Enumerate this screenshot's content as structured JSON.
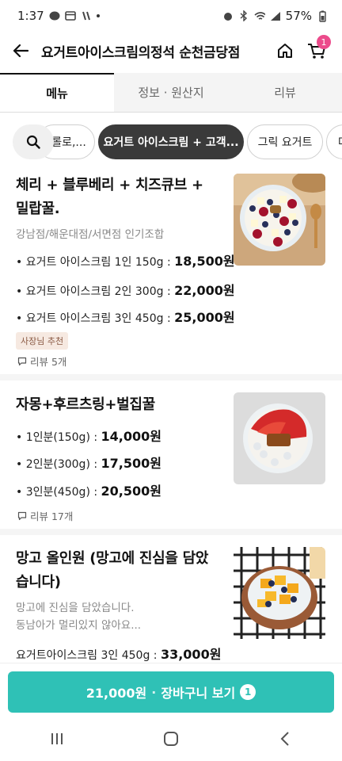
{
  "status_bar": {
    "time": "1:37",
    "battery": "57%"
  },
  "header": {
    "title": "요거트아이스크림의정석 순천금당점",
    "cart_count": "1"
  },
  "tabs": [
    {
      "label": "메뉴"
    },
    {
      "label": "정보 · 원산지"
    },
    {
      "label": "리뷰"
    }
  ],
  "chips": [
    {
      "label": "롤로,..."
    },
    {
      "label": "요거트 아이스크림 + 고객..."
    },
    {
      "label": "그릭 요거트"
    },
    {
      "label": "다"
    }
  ],
  "menu": [
    {
      "name": "체리 + 블루베리 + 치즈큐브 + 밀랍꿀.",
      "desc": "강남점/해운대점/서면점 인기조합",
      "prices": [
        {
          "label": "• 요거트 아이스크림 1인 150g : ",
          "price": "18,500원"
        },
        {
          "label": "• 요거트 아이스크림 2인 300g : ",
          "price": "22,000원"
        },
        {
          "label": "• 요거트 아이스크림 3인 450g : ",
          "price": "25,000원"
        }
      ],
      "tag": "사장님 추천",
      "review": "리뷰 5개"
    },
    {
      "name": "자몽+후르츠링+벌집꿀",
      "prices": [
        {
          "label": "• 1인분(150g) : ",
          "price": "14,000원"
        },
        {
          "label": "• 2인분(300g) : ",
          "price": "17,500원"
        },
        {
          "label": "• 3인분(450g) : ",
          "price": "20,500원"
        }
      ],
      "review": "리뷰 17개"
    },
    {
      "name": "망고 올인원 (망고에 진심을 담았습니다)",
      "desc_lines": [
        "망고에 진심을 담았습니다.",
        "동남아가 멀리있지 않아요..."
      ],
      "prices": [
        {
          "label": "요거트아이스크림 3인 450g : ",
          "price": "33,000원"
        }
      ]
    }
  ],
  "cart_bar": {
    "total": "21,000원",
    "label": "장바구니 보기",
    "count": "1"
  }
}
